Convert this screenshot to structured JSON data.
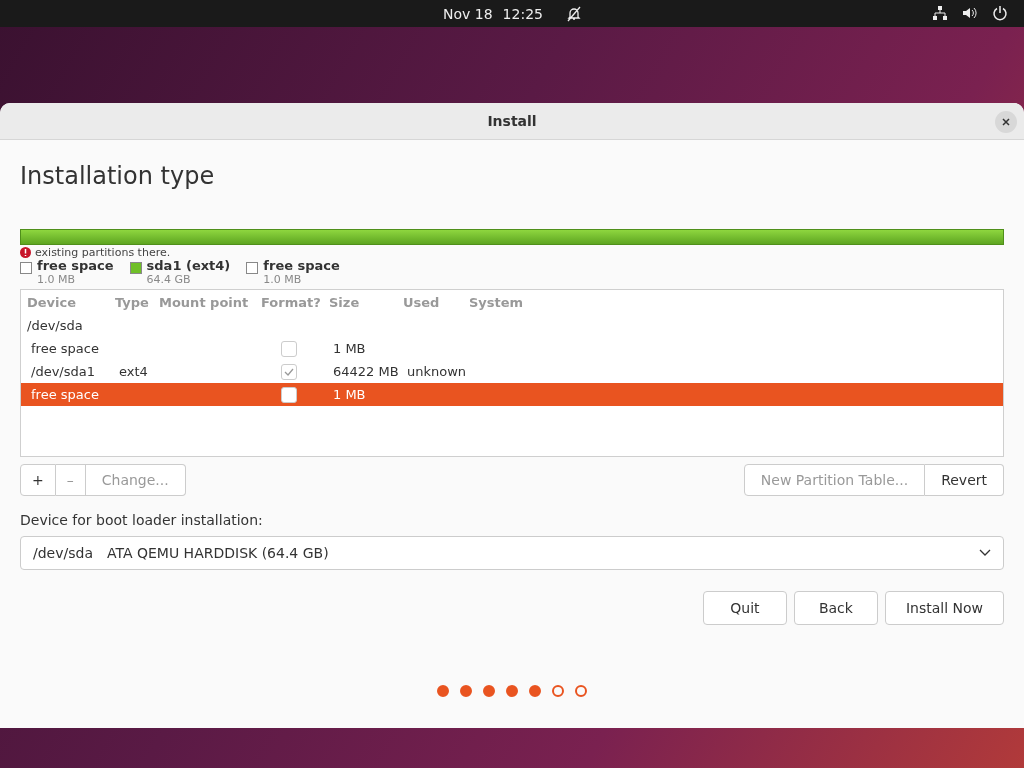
{
  "top_bar": {
    "date": "Nov 18",
    "time": "12:25"
  },
  "window": {
    "title": "Install"
  },
  "heading": "Installation type",
  "warning": "existing partitions there.",
  "legend": [
    {
      "name": "free space",
      "size": "1.0 MB",
      "color": "#ffffff"
    },
    {
      "name": "sda1 (ext4)",
      "size": "64.4 GB",
      "color": "#6fbf27"
    },
    {
      "name": "free space",
      "size": "1.0 MB",
      "color": "#ffffff"
    }
  ],
  "table": {
    "columns": [
      "Device",
      "Type",
      "Mount point",
      "Format?",
      "Size",
      "Used",
      "System"
    ],
    "rows": [
      {
        "kind": "disk",
        "device": "/dev/sda",
        "selected": false
      },
      {
        "kind": "partition",
        "device": "free space",
        "type": "",
        "mount": "",
        "format": false,
        "size": "1 MB",
        "used": "",
        "selected": false
      },
      {
        "kind": "partition",
        "device": "/dev/sda1",
        "type": "ext4",
        "mount": "",
        "format": true,
        "size": "64422 MB",
        "used": "unknown",
        "selected": false
      },
      {
        "kind": "partition",
        "device": "free space",
        "type": "",
        "mount": "",
        "format": false,
        "size": "1 MB",
        "used": "",
        "selected": true
      }
    ]
  },
  "table_buttons": {
    "add": "+",
    "remove": "–",
    "change": "Change...",
    "new_table": "New Partition Table...",
    "revert": "Revert"
  },
  "bootloader": {
    "label": "Device for boot loader installation:",
    "device": "/dev/sda",
    "description": "ATA QEMU HARDDISK (64.4 GB)"
  },
  "buttons": [
    "Quit",
    "Back",
    "Install Now"
  ],
  "progress_dots": [
    {
      "done": true
    },
    {
      "done": true
    },
    {
      "done": true
    },
    {
      "done": true
    },
    {
      "done": true
    },
    {
      "done": false
    },
    {
      "done": false
    }
  ]
}
